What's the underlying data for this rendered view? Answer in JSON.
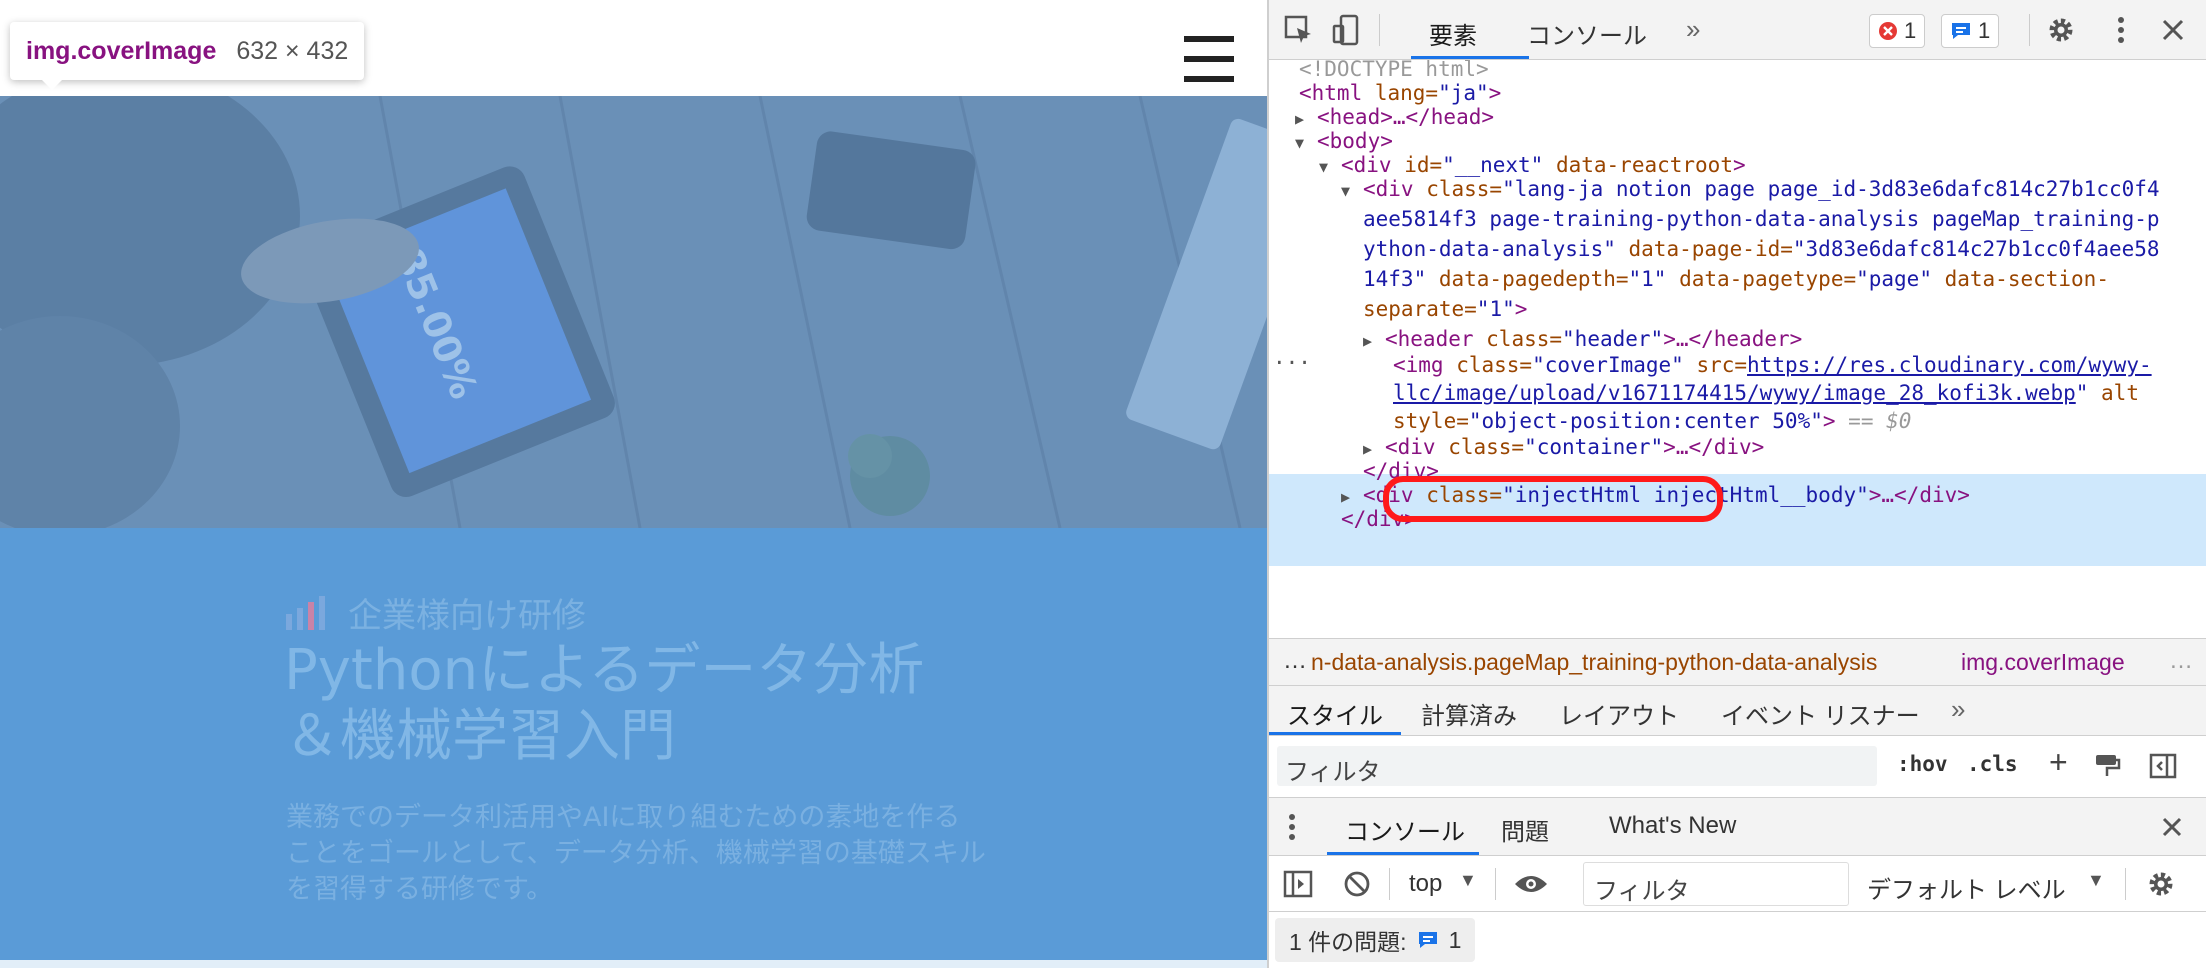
{
  "page": {
    "tooltip": {
      "tag": "img.coverImage",
      "size": "632 × 432"
    },
    "hero": {
      "label": "企業様向け研修",
      "title_line1": "Pythonによるデータ分析",
      "title_line2": "＆機械学習入門",
      "description": "業務でのデータ利活用やAIに取り組むための素地を作ることをゴールとして、データ分析、機械学習の基礎スキルを習得する研修です。"
    }
  },
  "devtools": {
    "tabs": [
      "要素",
      "コンソール"
    ],
    "errors_count": "1",
    "messages_count": "1",
    "dom": {
      "doctype": "<!DOCTYPE html>",
      "html_open_tag": "<html",
      "html_lang_attr": " lang=",
      "html_lang_val": "\"ja\"",
      "html_close": ">",
      "head": "<head>…</head>",
      "body": "<body>",
      "div_next_tag": "<div",
      "div_next_id_attr": " id=",
      "div_next_id_val": "\"__next\"",
      "div_next_reactroot": " data-reactroot",
      "div_next_close": ">",
      "page_div_tag": "<div",
      "page_div_class_attr": " class=",
      "page_div_class_val_1": "\"lang-ja notion page page_id-3d83e6dafc814c27b1cc0f4",
      "page_div_class_val_2": "aee5814f3 page-training-python-data-analysis pageMap_training-p",
      "page_div_class_val_3": "ython-data-analysis\"",
      "page_div_pageid_attr": " data-page-id=",
      "page_div_pageid_val_a": "\"3d83e6dafc814c27b1cc0f4aee58",
      "page_div_pageid_val_b": "14f3\"",
      "page_div_depth_attr": " data-pagedepth=",
      "page_div_depth_val": "\"1\"",
      "page_div_type_attr": " data-pagetype=",
      "page_div_type_val": "\"page\"",
      "page_div_section_attr": " data-section-",
      "page_div_section_attr2": "separate=",
      "page_div_section_val": "\"1\"",
      "page_div_close": ">",
      "header_tag": "<header",
      "header_class_attr": " class=",
      "header_class_val": "\"header\"",
      "header_rest": ">…</header>",
      "img_tag": "<img",
      "img_class_attr": " class=",
      "img_class_val": "\"coverImage\"",
      "img_src_attr": " src=",
      "img_src_val_1": "https://res.cloudinary.com/wywy-",
      "img_src_val_2": "llc/image/upload/v1671174415/wywy/image_28_kofi3k.webp",
      "img_alt_attr": " alt",
      "img_style_attr": "style=",
      "img_style_val": "\"object-position:center 50%\"",
      "img_close": ">",
      "img_eq": " == $0",
      "container_tag": "<div",
      "container_class_attr": " class=",
      "container_class_val": "\"container\"",
      "container_rest": ">…</div>",
      "div_close": "</div>",
      "inject_tag": "<div",
      "inject_class_attr": " class=",
      "inject_class_val": "\"injectHtml injectHtml__body\"",
      "inject_rest": ">…</div>",
      "div_close2": "</div>"
    },
    "breadcrumb": {
      "ellipsis": "…",
      "item1": "n-data-analysis.pageMap_training-python-data-analysis",
      "item2": "img.coverImage",
      "more": "…"
    },
    "styles_tabs": [
      "スタイル",
      "計算済み",
      "レイアウト",
      "イベント リスナー"
    ],
    "filter_placeholder": "フィルタ",
    "hov": ":hov",
    "cls": ".cls",
    "plus": "+",
    "drawer_tabs": [
      "コンソール",
      "問題",
      "What's New"
    ],
    "console_context": "top",
    "console_filter_placeholder": "フィルタ",
    "console_level": "デフォルト レベル",
    "issues_text": "1 件の問題:",
    "issues_count": "1"
  }
}
